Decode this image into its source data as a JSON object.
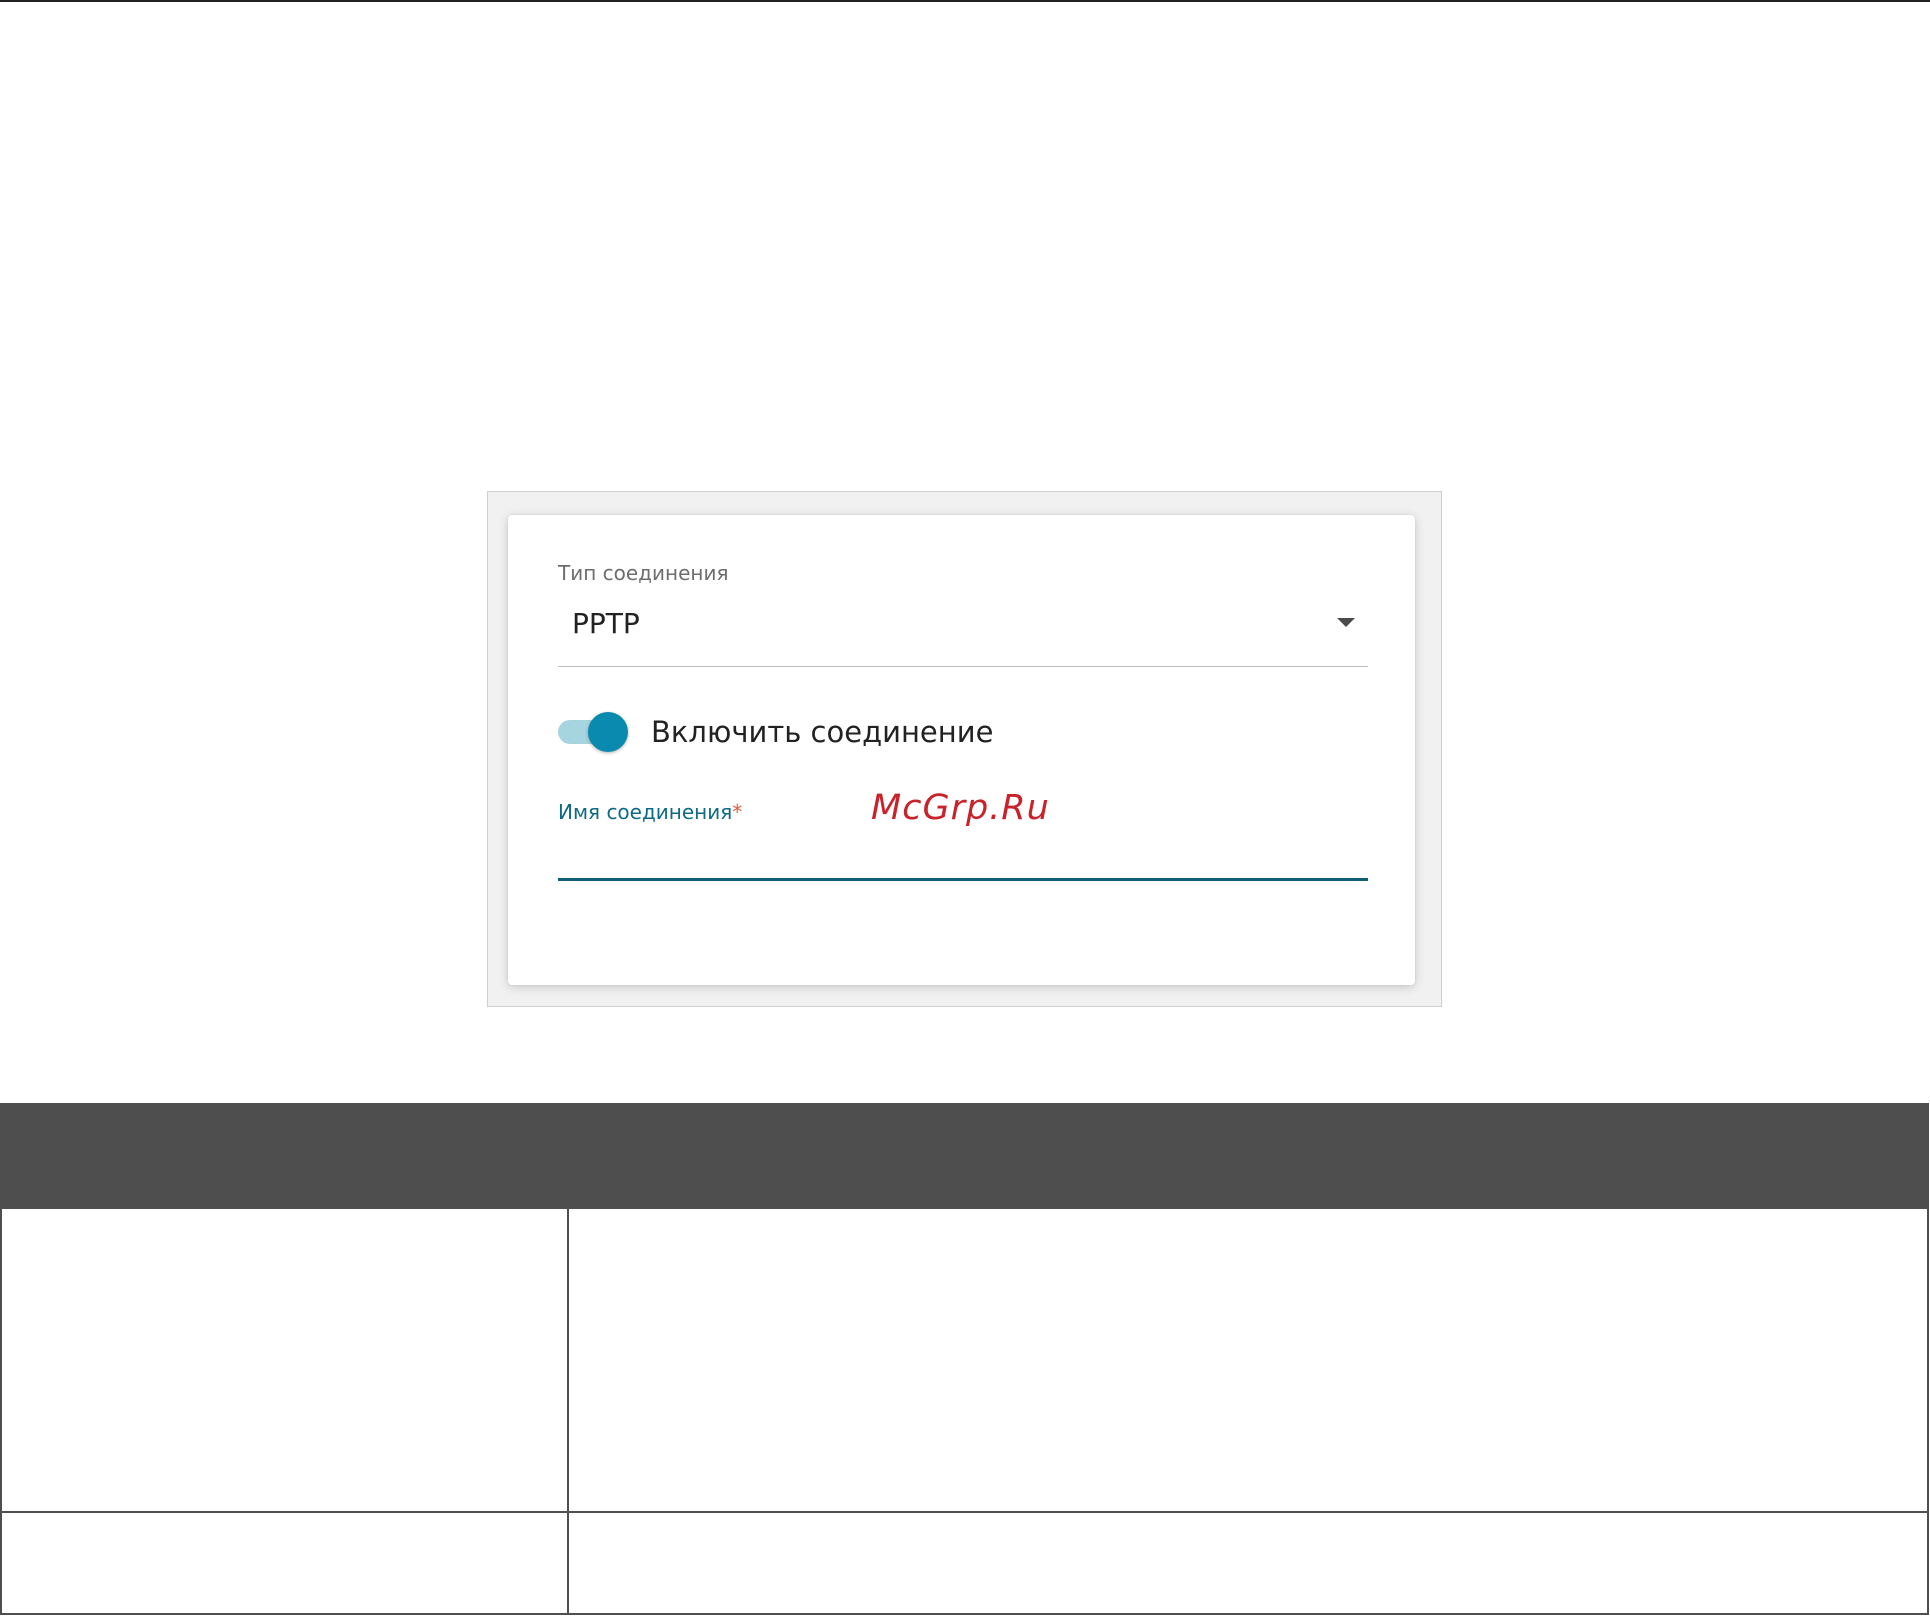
{
  "form": {
    "connection_type_label": "Тип соединения",
    "connection_type_value": "PPTP",
    "enable_connection_label": "Включить соединение",
    "enable_connection_on": true,
    "connection_name_label": "Имя соединения",
    "connection_name_required_mark": "*",
    "connection_name_value": "",
    "accent_color": "#0b8ab0"
  },
  "watermark": {
    "text": "McGrp.Ru",
    "color": "#c8222a"
  },
  "table": {
    "header_color": "#4e4e4e",
    "rows": [
      {
        "parameter": "",
        "description": ""
      },
      {
        "parameter": "",
        "description": ""
      }
    ]
  },
  "icons": {
    "dropdown": "chevron-down-icon"
  }
}
